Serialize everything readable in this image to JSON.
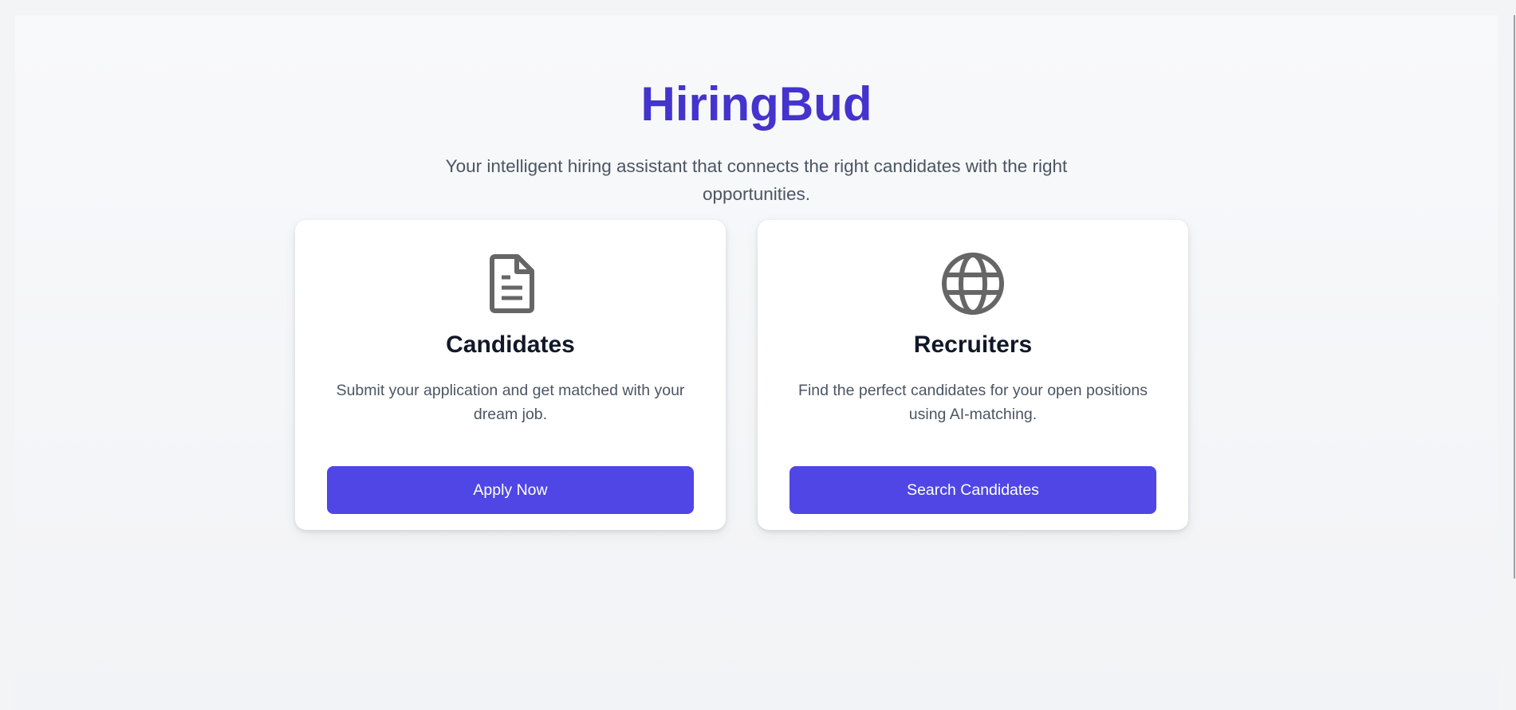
{
  "header": {
    "title": "HiringBud",
    "subtitle": "Your intelligent hiring assistant that connects the right candidates with the right opportunities."
  },
  "cards": [
    {
      "icon": "document-icon",
      "title": "Candidates",
      "description": "Submit your application and get matched with your dream job.",
      "button_label": "Apply Now"
    },
    {
      "icon": "globe-icon",
      "title": "Recruiters",
      "description": "Find the perfect candidates for your open positions using AI-matching.",
      "button_label": "Search Candidates"
    }
  ],
  "colors": {
    "brand": "#4433cc",
    "button": "#4f46e5",
    "icon": "#666666",
    "heading": "#111827",
    "body_text": "#4b5563"
  }
}
